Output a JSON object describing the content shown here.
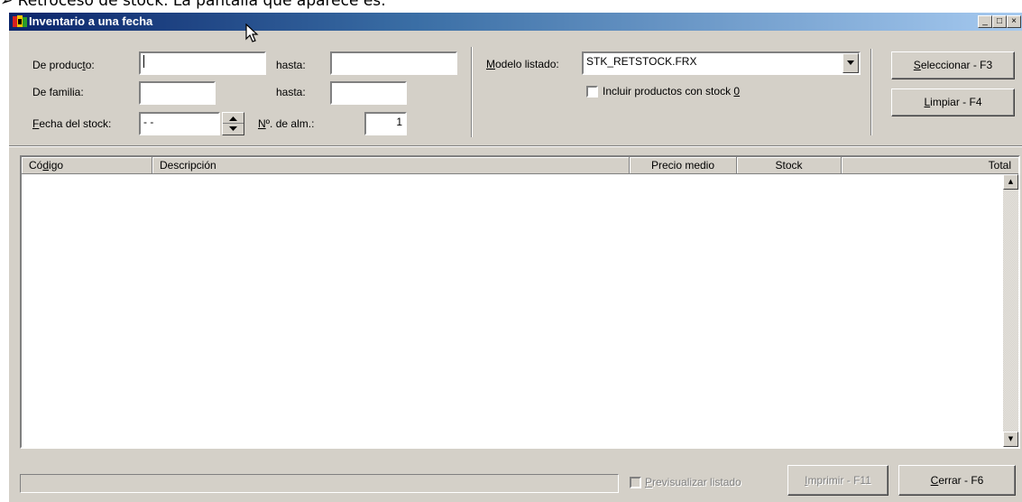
{
  "document": {
    "intro_line": "➢ Retroceso de stock. La pantalla que aparece es:"
  },
  "window": {
    "title": "Inventario a una fecha",
    "controls": {
      "minimize": "_",
      "maximize": "□",
      "close": "×"
    }
  },
  "filters": {
    "de_producto": {
      "label_pre": "De produc",
      "label_u": "t",
      "label_post": "o:",
      "value": ""
    },
    "hasta_producto": {
      "label": "hasta:",
      "value": ""
    },
    "de_familia": {
      "label": "De familia:",
      "value": ""
    },
    "hasta_familia": {
      "label": "hasta:",
      "value": ""
    },
    "fecha_stock": {
      "label_u": "F",
      "label_rest": "echa del stock:",
      "value": " - -"
    },
    "num_alm": {
      "label_u": "N",
      "label_rest": "º. de alm.:",
      "value": "1"
    }
  },
  "report": {
    "modelo_label_u": "M",
    "modelo_label_rest": "odelo listado:",
    "modelo_value": "STK_RETSTOCK.FRX",
    "include_zero_label": "Incluir productos con stock ",
    "include_zero_u": "0",
    "include_zero_checked": false
  },
  "actions": {
    "seleccionar_u": "S",
    "seleccionar_rest": "eleccionar - F3",
    "limpiar_u": "L",
    "limpiar_rest": "impiar - F4"
  },
  "table": {
    "columns": {
      "codigo_pre": "Có",
      "codigo_u": "d",
      "codigo_post": "igo",
      "descripcion": "Descripción",
      "precio_medio": "Precio medio",
      "stock": "Stock",
      "total": "Total"
    },
    "rows": []
  },
  "footer": {
    "preview_u": "P",
    "preview_rest": "revisualizar listado",
    "preview_checked": false,
    "imprimir_u": "I",
    "imprimir_rest": "mprimir - F11",
    "cerrar_u": "C",
    "cerrar_rest": "errar - F6",
    "status_text": ""
  },
  "icons": [
    "app-icon",
    "mouse-cursor-icon",
    "spinner-up-icon",
    "spinner-down-icon",
    "dropdown-arrow-icon",
    "scroll-up-arrow-icon",
    "scroll-down-arrow-icon"
  ],
  "colors": {
    "titlebar_start": "#0a246a",
    "titlebar_end": "#a6caf0",
    "face": "#d4d0c8"
  }
}
